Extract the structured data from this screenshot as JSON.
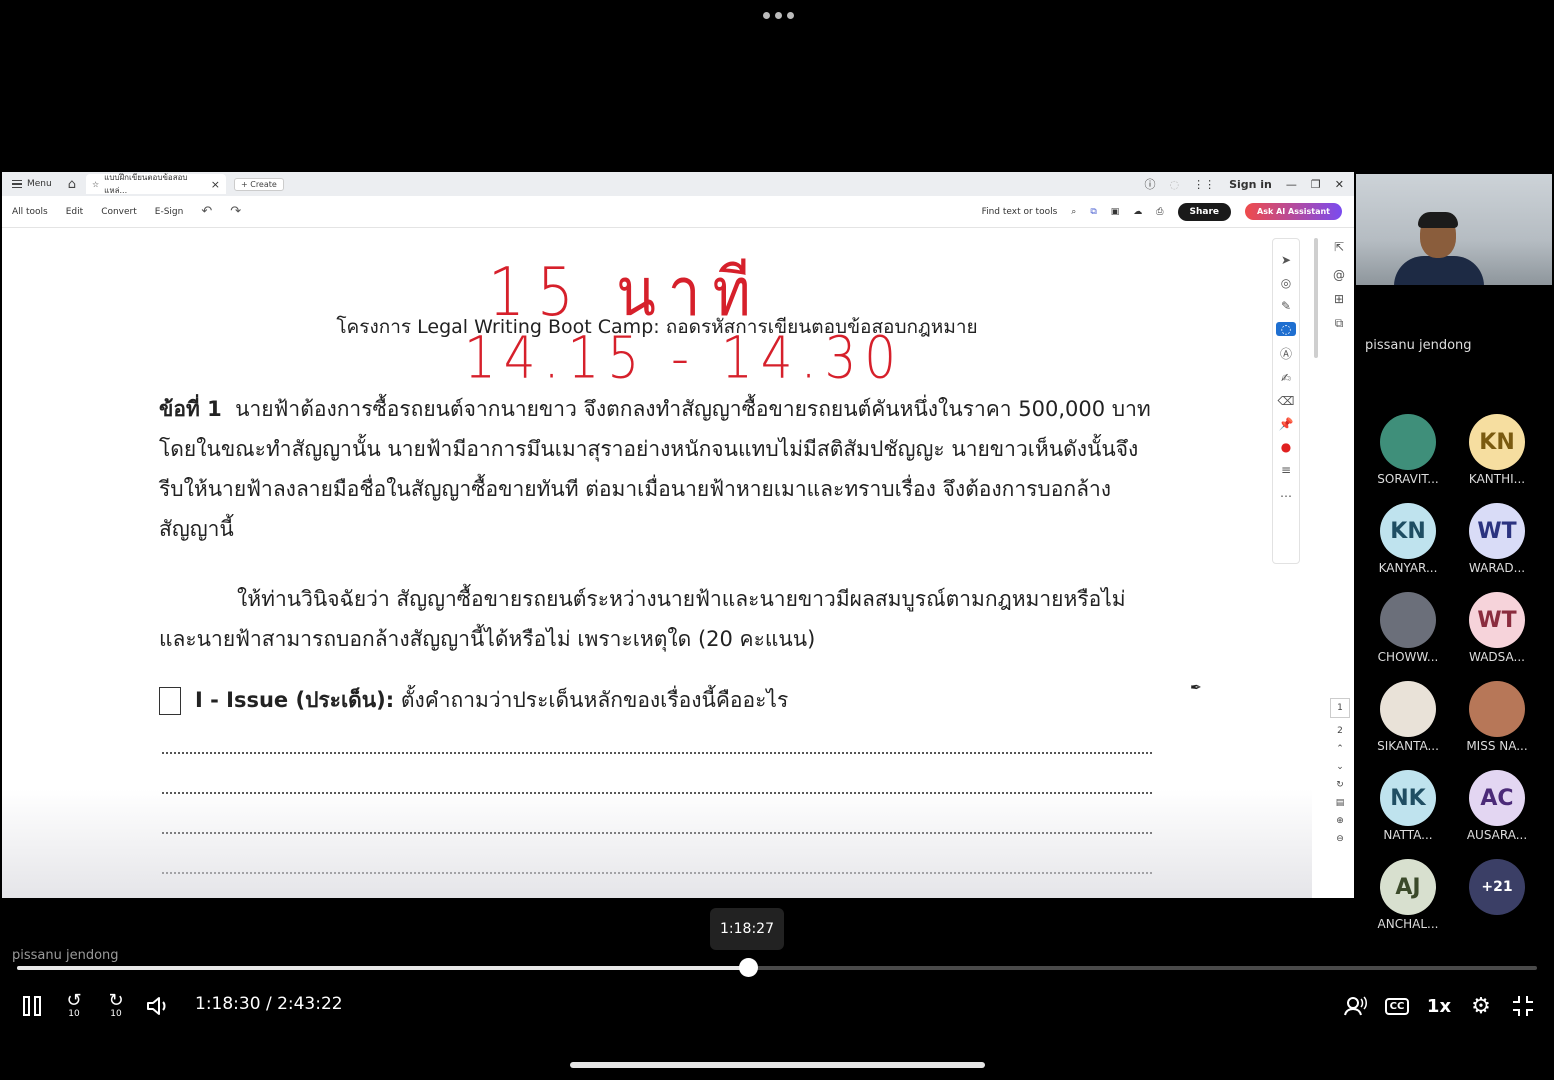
{
  "acrobat": {
    "menu_label": "Menu",
    "tab_title": "แบบฝึกเขียนตอบข้อสอบแหล่...",
    "create_label": "Create",
    "sign_in": "Sign in",
    "toolbar": {
      "all_tools": "All tools",
      "edit": "Edit",
      "convert": "Convert",
      "esign": "E-Sign",
      "find_placeholder": "Find text or tools",
      "share": "Share",
      "ask_ai": "Ask AI Assistant"
    }
  },
  "document": {
    "annotation_top": "15 นาที",
    "annotation_time": "14.15 - 14.30",
    "title": "โครงการ Legal Writing Boot Camp: ถอดรหัสการเขียนตอบข้อสอบกฎหมาย",
    "question_number": "ข้อที่ 1",
    "question_text": "นายฟ้าต้องการซื้อรถยนต์จากนายขาว จึงตกลงทำสัญญาซื้อขายรถยนต์คันหนึ่งในราคา 500,000 บาท โดยในขณะทำสัญญานั้น นายฟ้ามีอาการมึนเมาสุราอย่างหนักจนแทบไม่มีสติสัมปชัญญะ นายขาวเห็นดังนั้นจึงรีบให้นายฟ้าลงลายมือชื่อในสัญญาซื้อขายทันที ต่อมาเมื่อนายฟ้าหายเมาและทราบเรื่อง จึงต้องการบอกล้างสัญญานี้",
    "instruction": "ให้ท่านวินิจฉัยว่า สัญญาซื้อขายรถยนต์ระหว่างนายฟ้าและนายขาวมีผลสมบูรณ์ตามกฎหมายหรือไม่ และนายฟ้าสามารถบอกล้างสัญญานี้ได้หรือไม่ เพราะเหตุใด (20 คะแนน)",
    "issue_label": "I - Issue (ประเด็น):",
    "issue_prompt": "ตั้งคำถามว่าประเด็นหลักของเรื่องนี้คืออะไร",
    "page_current": "1",
    "page_next": "2"
  },
  "meeting": {
    "speaker_name": "pissanu jendong",
    "participants": [
      {
        "initials": "",
        "name": "SORAVIT...",
        "kind": "photo",
        "color": "#3f8f7a"
      },
      {
        "initials": "KN",
        "name": "KANTHI...",
        "kind": "initials",
        "color": "#f6dea0",
        "text_color": "#7a5a10"
      },
      {
        "initials": "KN",
        "name": "KANYAR...",
        "kind": "initials",
        "color": "#bfe3ee",
        "text_color": "#1f4e63"
      },
      {
        "initials": "WT",
        "name": "WARAD...",
        "kind": "initials",
        "color": "#d9dcf7",
        "text_color": "#2b3380"
      },
      {
        "initials": "",
        "name": "CHOWW...",
        "kind": "photo",
        "color": "#6b6f7a"
      },
      {
        "initials": "WT",
        "name": "WADSA...",
        "kind": "initials",
        "color": "#f6d3da",
        "text_color": "#8a2c3e"
      },
      {
        "initials": "",
        "name": "SIKANTA...",
        "kind": "photo",
        "color": "#e9e2d8"
      },
      {
        "initials": "",
        "name": "MISS NA...",
        "kind": "photo",
        "color": "#b77758"
      },
      {
        "initials": "NK",
        "name": "NATTA...",
        "kind": "initials",
        "color": "#bfe3ee",
        "text_color": "#1f4e63"
      },
      {
        "initials": "AC",
        "name": "AUSARA...",
        "kind": "initials",
        "color": "#e3d6f2",
        "text_color": "#4b2a78"
      },
      {
        "initials": "AJ",
        "name": "ANCHAL...",
        "kind": "initials",
        "color": "#d8e0cf",
        "text_color": "#3b4a2a"
      },
      {
        "initials": "+21",
        "name": "",
        "kind": "more",
        "color": "#3b3f66",
        "text_color": "#ffffff"
      }
    ]
  },
  "player": {
    "presenter_caption": "pissanu jendong",
    "hover_time": "1:18:27",
    "current_time": "1:18:30",
    "duration": "2:43:22",
    "time_display": "1:18:30 / 2:43:22",
    "progress_fraction": 0.4807,
    "speed": "1x",
    "skip_back": "10",
    "skip_forward": "10",
    "cc_label": "CC"
  }
}
